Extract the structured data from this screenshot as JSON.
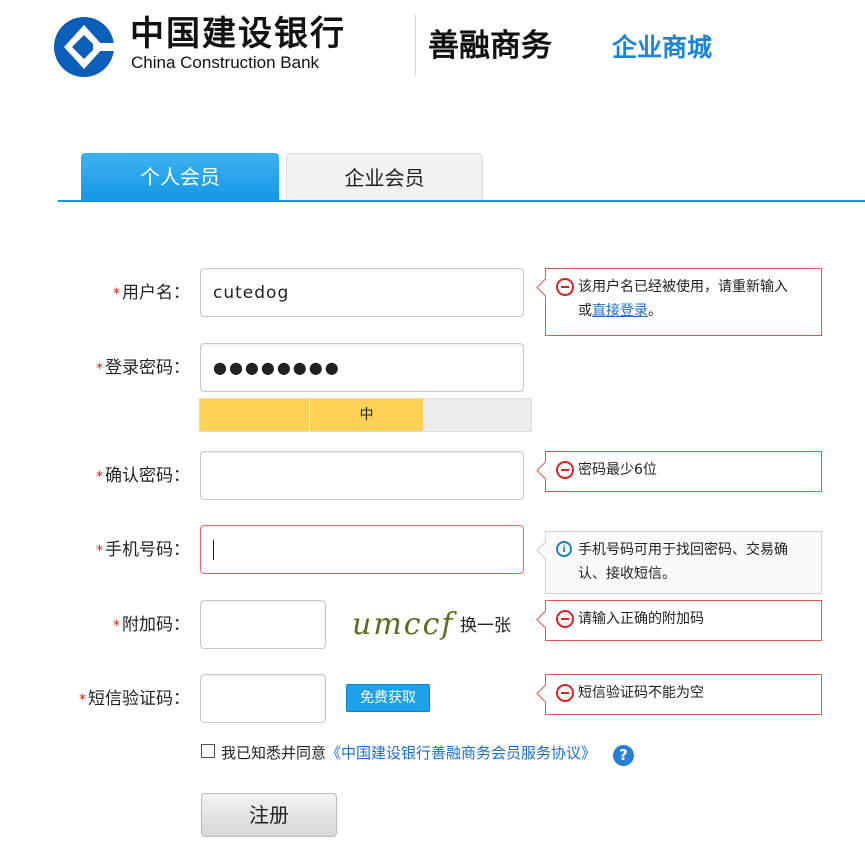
{
  "header": {
    "brand_cn": "中国建设银行",
    "brand_en": "China Construction Bank",
    "subtitle": "善融商务",
    "mall": "企业商城",
    "accent_color": "#1a85d6"
  },
  "tabs": [
    {
      "label": "个人会员",
      "active": true
    },
    {
      "label": "企业会员",
      "active": false
    }
  ],
  "form": {
    "required_mark": "*",
    "username": {
      "label": "用户名：",
      "value": "cutedog"
    },
    "password": {
      "label": "登录密码：",
      "value": "●●●●●●●●",
      "strength_label": "中"
    },
    "confirm_password": {
      "label": "确认密码：",
      "value": ""
    },
    "phone": {
      "label": "手机号码：",
      "value": ""
    },
    "captcha": {
      "label": "附加码：",
      "value": "",
      "image_text": "umccf",
      "refresh_label": "换一张"
    },
    "sms_code": {
      "label": "短信验证码：",
      "value": "",
      "button_label": "免费获取"
    },
    "agreement": {
      "text": "我已知悉并同意",
      "link": "《中国建设银行善融商务会员服务协议》",
      "checked": false
    },
    "submit_label": "注册"
  },
  "messages": {
    "username_error": "该用户名已经被使用，请重新输入",
    "username_error_or": "或",
    "username_error_link": "直接登录",
    "username_error_end": "。",
    "password_error": "密码最少6位",
    "phone_info": "手机号码可用于找回密码、交易确认、接收短信。",
    "captcha_error": "请输入正确的附加码",
    "sms_error": "短信验证码不能为空"
  },
  "colors": {
    "error": "#e02020",
    "link": "#1a6fd0",
    "strength": "#ffd257"
  }
}
